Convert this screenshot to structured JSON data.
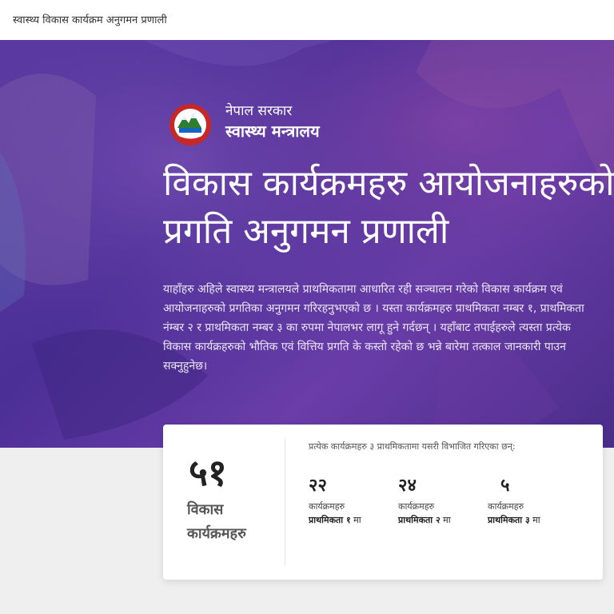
{
  "header": {
    "title": "स्वास्थ्य विकास कार्यक्रम अनुगमन प्रणाली"
  },
  "ministry": {
    "line1": "नेपाल सरकार",
    "line2": "स्वास्थ्य मन्त्रालय"
  },
  "hero": {
    "headline_line1": "विकास कार्यक्रमहरु आयोजनाहरुको",
    "headline_line2": "प्रगति अनुगमन प्रणाली",
    "description": "याहाँहरु अहिले स्वास्थ्य मन्त्रालयले प्राथमिकतामा आधारित रही सञ्चालन गरेको विकास कार्यक्रम एवं आयोजनाहरुको प्रगतिका अनुगमन गरिरहनुभएको छ । यस्ता कार्यक्रमहरु प्राथमिकता नम्बर १, प्राथमिकता नंम्बर २ र प्राथमिकता नम्बर ३ का रुपमा नेपालभर लागू हुने गर्दछन् । यहाँबाट तपाईहरुले त्यस्ता प्रत्येक विकास कार्यक्रहरुको भौतिक एवं वित्तिय प्रगति के कस्तो रहेको छ भन्ने बारेमा तत्काल जानकारी पाउन सक्नुहुनेछ।"
  },
  "summary": {
    "total": "५१",
    "total_label_line1": "विकास",
    "total_label_line2": "कार्यक्रमहरु",
    "note": "प्रत्येक कार्यक्रमहरु ३ प्राथमिकतामा यसरी विभाजित गरिएका छन्:",
    "priorities": [
      {
        "count": "२२",
        "label": "कार्यक्रमहरु",
        "priority": "प्राथमिकता १",
        "suffix": " मा"
      },
      {
        "count": "२४",
        "label": "कार्यक्रमहरु",
        "priority": "प्राथमिकता २",
        "suffix": " मा"
      },
      {
        "count": "५",
        "label": "कार्यक्रमहरु",
        "priority": "प्राथमिकता ३",
        "suffix": " मा"
      }
    ]
  },
  "colors": {
    "hero_overlay": "#5a3aa0",
    "card_bg": "#ffffff",
    "page_bg": "#efefef"
  },
  "icons": {
    "emblem": "nepal-emblem-icon"
  }
}
